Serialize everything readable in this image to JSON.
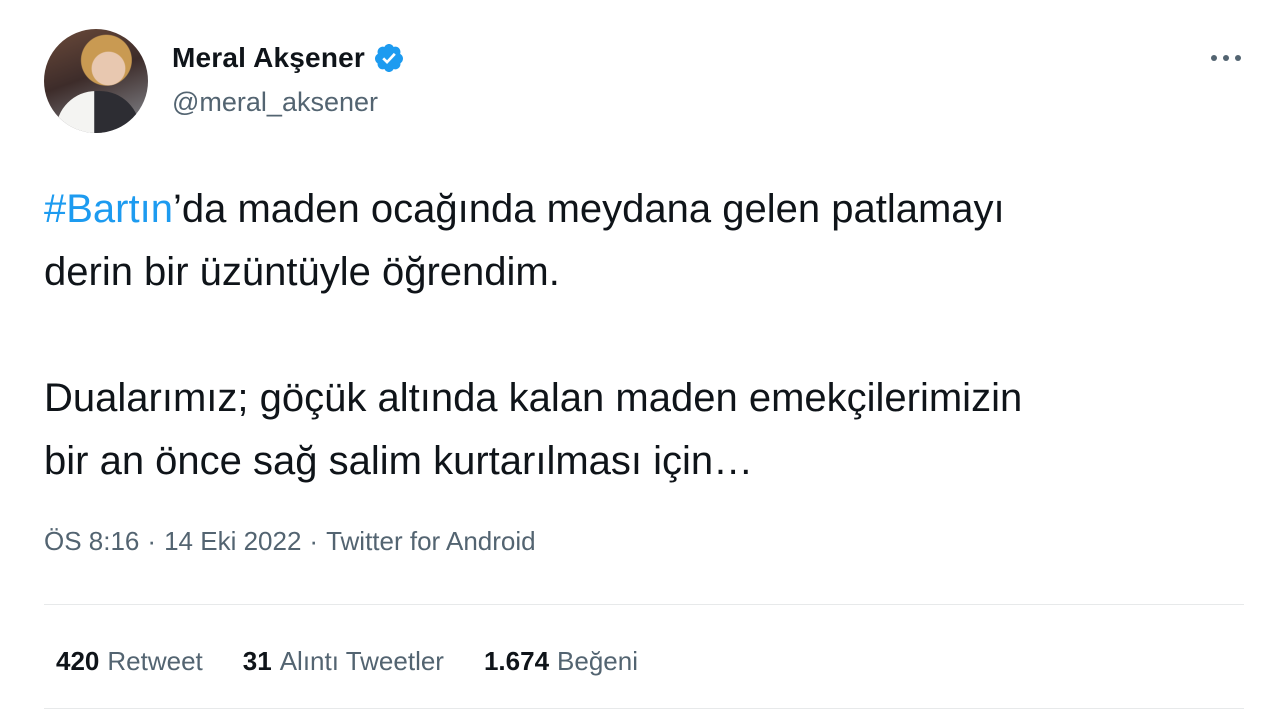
{
  "author": {
    "display_name": "Meral Akşener",
    "handle": "@meral_aksener",
    "verified_icon": "verified-badge-icon"
  },
  "tweet": {
    "hashtag": "#Bartın",
    "line1_rest": "’da maden ocağında meydana gelen patlamayı",
    "line2": "derin bir üzüntüyle öğrendim.",
    "line3": "Dualarımız; göçük altında kalan maden emekçilerimizin",
    "line4": "bir an önce sağ salim kurtarılması için…"
  },
  "meta": {
    "time": "ÖS 8:16",
    "separator": "·",
    "date": "14 Eki 2022",
    "source": "Twitter for Android"
  },
  "stats": {
    "retweets_count": "420",
    "retweets_label": "Retweet",
    "quotes_count": "31",
    "quotes_label": "Alıntı Tweetler",
    "likes_count": "1.674",
    "likes_label": "Beğeni"
  },
  "more_icon": "more-horizontal-icon",
  "colors": {
    "text": "#0f1419",
    "secondary": "#536471",
    "link": "#1d9bf0",
    "divider": "#e7e9ea"
  }
}
